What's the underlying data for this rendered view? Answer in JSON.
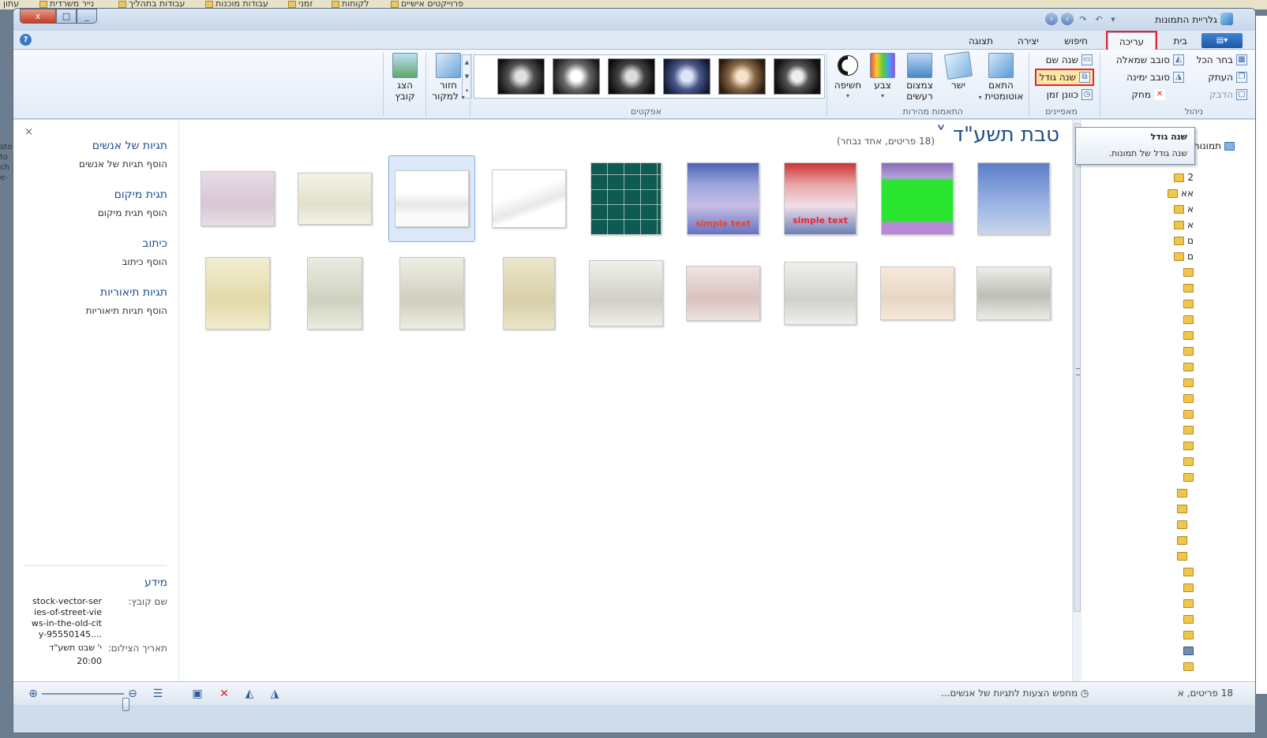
{
  "desktop": {
    "bookmarks": [
      "עתון",
      "נייר משרדית",
      "עבודות בתהליך",
      "עבודות מוכנות",
      "זמני",
      "לקוחות",
      "פרוייקטים אישיים"
    ],
    "left_text": [
      "sto",
      "to",
      "ch",
      "e-"
    ]
  },
  "window": {
    "title": "גלריית התמונות",
    "close_label": "x",
    "max_label": "□",
    "min_label": "_"
  },
  "ribbon": {
    "file_label": "▾",
    "help_label": "?",
    "tabs": [
      {
        "label": "בית",
        "active": false
      },
      {
        "label": "עריכה",
        "active": true
      },
      {
        "label": "חיפוש",
        "active": false
      },
      {
        "label": "יצירה",
        "active": false
      },
      {
        "label": "תצוגה",
        "active": false
      }
    ],
    "groups": {
      "manage": {
        "label": "ניהול",
        "select_all": "בחר הכל",
        "copy": "העתק",
        "paste": "הדבק",
        "rotate_left": "סובב שמאלה",
        "rotate_right": "סובב ימינה",
        "delete": "מחק"
      },
      "properties": {
        "label": "מאפיינים",
        "rename": "שנה שם",
        "resize": "שנה גודל",
        "adjust_time": "כוונן זמן"
      },
      "quick_fixes": {
        "label": "התאמות מהירות",
        "auto_adjust": [
          "התאם",
          "אוטומטית"
        ],
        "straighten": "ישר",
        "reduce_noise": [
          "צמצום",
          "רעשים"
        ],
        "color": "צבע",
        "exposure": "חשיפה"
      },
      "effects": {
        "label": "אפקטים"
      },
      "revert": [
        "חזור",
        "למקור"
      ],
      "show_file": [
        "הצג",
        "קובץ"
      ]
    }
  },
  "tooltip": {
    "title": "שנה גודל",
    "body": "שנה גודל של תמונות."
  },
  "pane": {
    "close_label": "×",
    "people_tags": "תגיות של אנשים",
    "add_people_tags": "הוסף תגיות של אנשים",
    "location_tag": "תגית מיקום",
    "add_location_tag": "הוסף תגית מיקום",
    "caption": "כיתוב",
    "add_caption": "הוסף כיתוב",
    "descriptive_tags": "תגיות תיאוריות",
    "add_descriptive_tags": "הוסף תגיות תיאוריות",
    "info": "מידע",
    "file_name_label": "שם קובץ:",
    "file_name": "stock-vector-series-of-street-views-in-the-old-city-95550145....",
    "date_label": "תאריך הצילום:",
    "date_value": "י' שבט תשע\"ד",
    "time_value": "20:00"
  },
  "gallery": {
    "title": "טבת תשע\"ד",
    "subtitle": "(18 פריטים, אחד נבחר)",
    "thumb_texts": [
      "simple text",
      "simple text"
    ]
  },
  "nav": {
    "items": [
      "2",
      "אא",
      "א",
      "א",
      "ם",
      "ם"
    ],
    "pictures_label": "תמונות"
  },
  "status": {
    "count": "18 פריטים, א",
    "search": "מחפש הצעות לתגיות של אנשים..."
  },
  "colors": {
    "accent_blue": "#1f4e8c",
    "highlight_red": "#e8242d",
    "selection": "#dce9f9"
  }
}
